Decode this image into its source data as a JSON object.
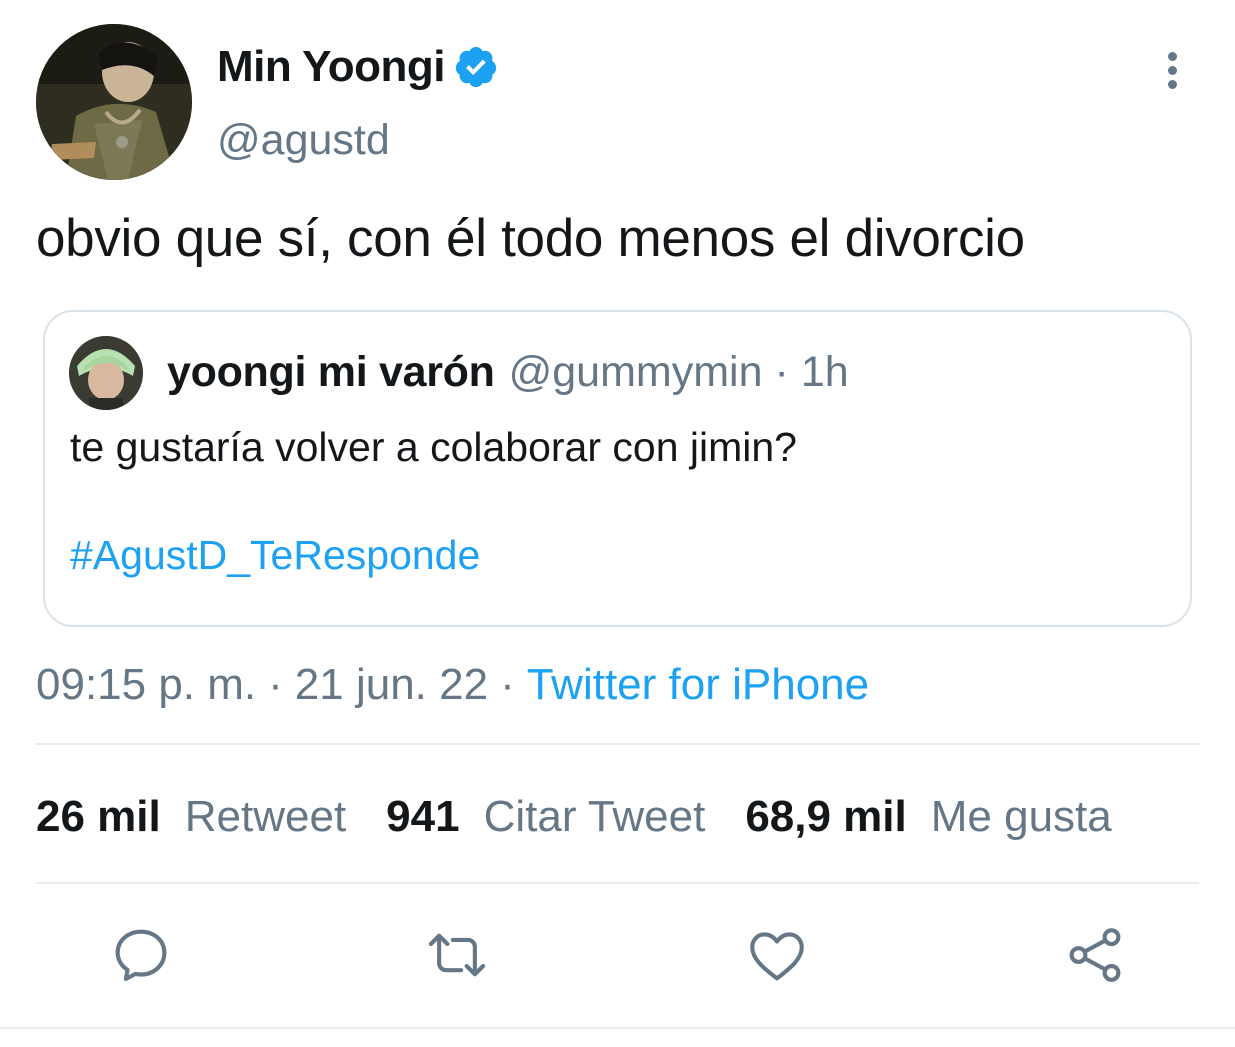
{
  "author": {
    "display_name": "Min Yoongi",
    "handle": "@agustd",
    "verified": true,
    "avatar_icon": "profile-photo"
  },
  "tweet": {
    "text": "obvio que sí, con él todo menos el divorcio"
  },
  "quote": {
    "display_name": "yoongi mi varón",
    "handle": "@gummymin",
    "separator": "·",
    "time": "1h",
    "text": "te gustaría volver a colaborar con jimin?",
    "hashtag": "#AgustD_TeResponde"
  },
  "meta": {
    "time": "09:15 p. m.",
    "separator": "·",
    "date": "21 jun. 22",
    "source": "Twitter for iPhone"
  },
  "stats": [
    {
      "count": "26 mil",
      "label": "Retweet"
    },
    {
      "count": "941",
      "label": "Citar Tweet"
    },
    {
      "count": "68,9 mil",
      "label": "Me gusta"
    }
  ],
  "actions": [
    "reply-icon",
    "retweet-icon",
    "like-icon",
    "share-icon"
  ],
  "colors": {
    "text": "#14171a",
    "secondary": "#657786",
    "accent": "#1da1f2",
    "border": "#dbe3ea"
  }
}
